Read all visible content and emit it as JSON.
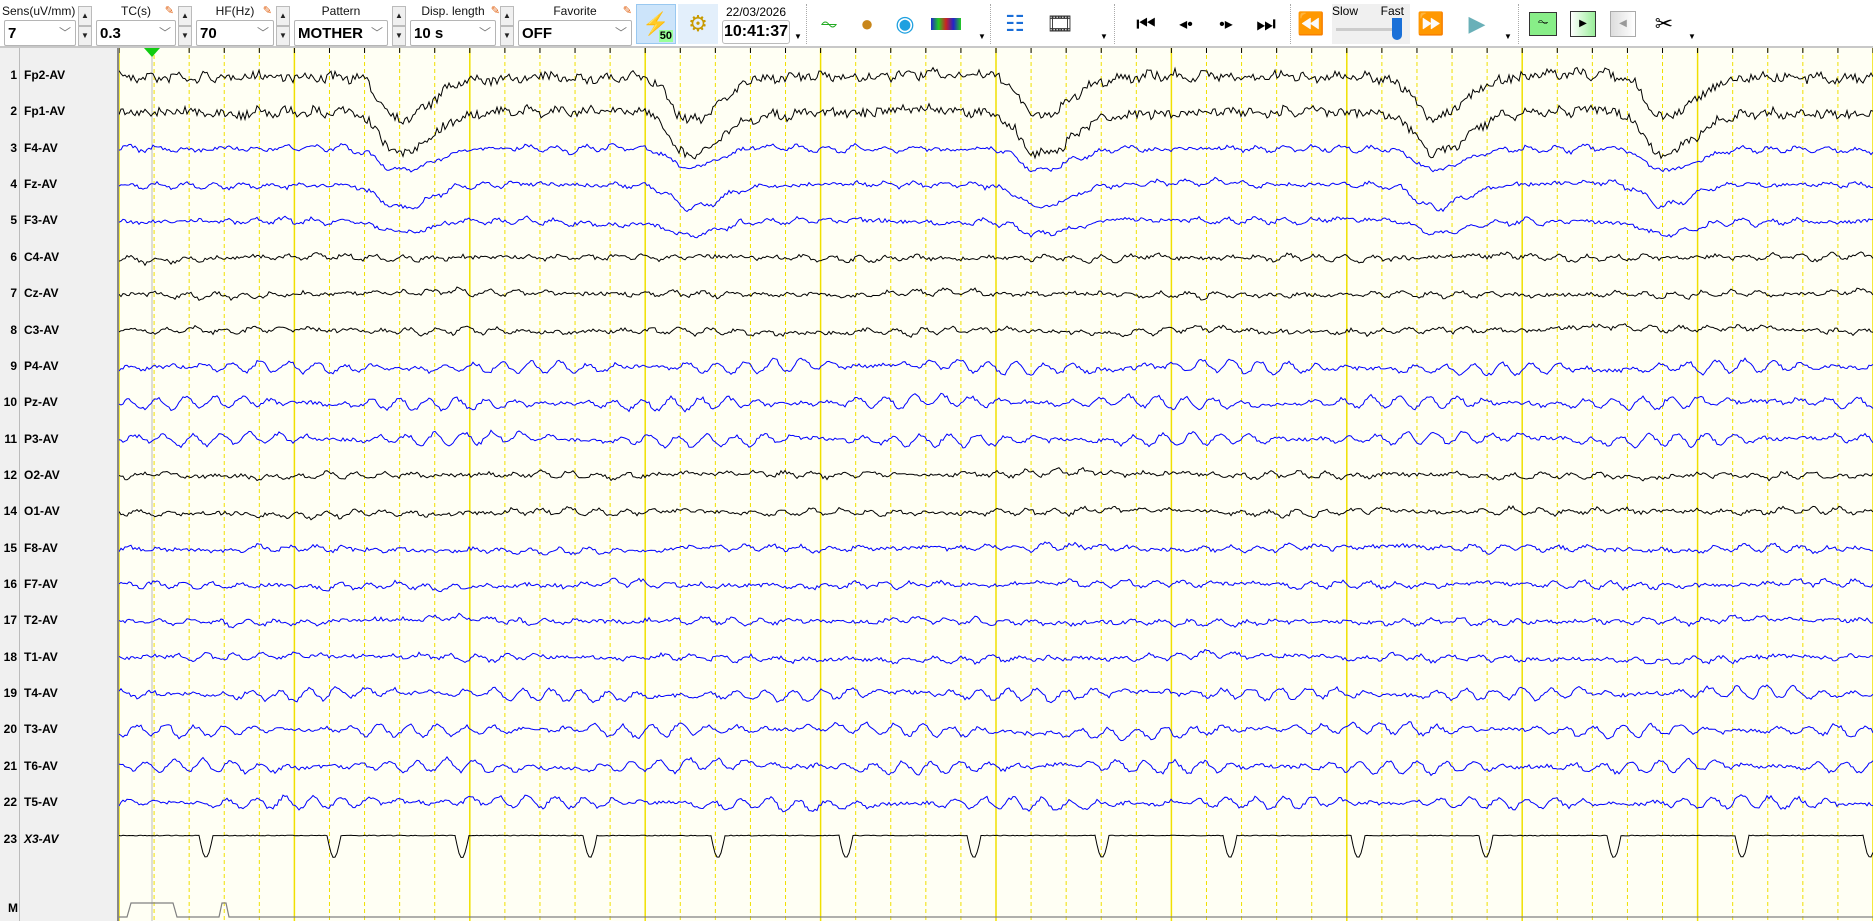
{
  "toolbar": {
    "sens": {
      "label": "Sens(uV/mm)",
      "value": "7"
    },
    "tc": {
      "label": "TC(s)",
      "value": "0.3"
    },
    "hf": {
      "label": "HF(Hz)",
      "value": "70"
    },
    "pattern": {
      "label": "Pattern",
      "value": "MOTHER"
    },
    "disp_length": {
      "label": "Disp. length",
      "value": "10 s"
    },
    "favorite": {
      "label": "Favorite",
      "value": "OFF"
    },
    "notch_badge": "50",
    "date": "22/03/2026",
    "time": "10:41:37",
    "speed_slow": "Slow",
    "speed_fast": "Fast",
    "speed_value": 1.0
  },
  "channels": [
    {
      "num": "1",
      "name": "Fp2-AV",
      "color": "#000000"
    },
    {
      "num": "2",
      "name": "Fp1-AV",
      "color": "#000000"
    },
    {
      "num": "3",
      "name": "F4-AV",
      "color": "#0000ff"
    },
    {
      "num": "4",
      "name": "Fz-AV",
      "color": "#0000ff"
    },
    {
      "num": "5",
      "name": "F3-AV",
      "color": "#0000ff"
    },
    {
      "num": "6",
      "name": "C4-AV",
      "color": "#000000"
    },
    {
      "num": "7",
      "name": "Cz-AV",
      "color": "#000000"
    },
    {
      "num": "8",
      "name": "C3-AV",
      "color": "#000000"
    },
    {
      "num": "9",
      "name": "P4-AV",
      "color": "#0000ff"
    },
    {
      "num": "10",
      "name": "Pz-AV",
      "color": "#0000ff"
    },
    {
      "num": "11",
      "name": "P3-AV",
      "color": "#0000ff"
    },
    {
      "num": "12",
      "name": "O2-AV",
      "color": "#000000"
    },
    {
      "num": "14",
      "name": "O1-AV",
      "color": "#000000"
    },
    {
      "num": "15",
      "name": "F8-AV",
      "color": "#0000ff"
    },
    {
      "num": "16",
      "name": "F7-AV",
      "color": "#0000ff"
    },
    {
      "num": "17",
      "name": "T2-AV",
      "color": "#0000ff"
    },
    {
      "num": "18",
      "name": "T1-AV",
      "color": "#0000ff"
    },
    {
      "num": "19",
      "name": "T4-AV",
      "color": "#0000ff"
    },
    {
      "num": "20",
      "name": "T3-AV",
      "color": "#0000ff"
    },
    {
      "num": "21",
      "name": "T6-AV",
      "color": "#0000ff"
    },
    {
      "num": "22",
      "name": "T5-AV",
      "color": "#0000ff"
    },
    {
      "num": "23",
      "name": "X3-AV",
      "color": "#000000"
    },
    {
      "num": "",
      "name": "M",
      "color": "#808080"
    }
  ],
  "display_seconds": 10
}
